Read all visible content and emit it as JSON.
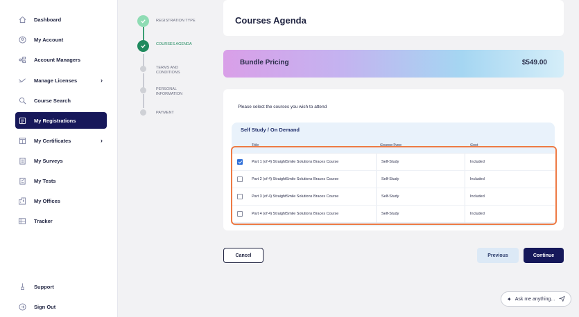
{
  "sidebar": {
    "items": [
      {
        "label": "Dashboard",
        "icon": "home-icon"
      },
      {
        "label": "My Account",
        "icon": "account-icon"
      },
      {
        "label": "Account Managers",
        "icon": "managers-icon"
      },
      {
        "label": "Manage Licenses",
        "icon": "license-icon",
        "chevron": "›"
      },
      {
        "label": "Course Search",
        "icon": "search-icon"
      },
      {
        "label": "My Registrations",
        "icon": "registrations-icon",
        "active": true
      },
      {
        "label": "My Certificates",
        "icon": "certificate-icon",
        "chevron": "›"
      },
      {
        "label": "My Surveys",
        "icon": "survey-icon"
      },
      {
        "label": "My Tests",
        "icon": "tests-icon"
      },
      {
        "label": "My Offices",
        "icon": "offices-icon"
      },
      {
        "label": "Tracker",
        "icon": "tracker-icon"
      }
    ],
    "support": "Support",
    "sign_out": "Sign Out"
  },
  "stepper": {
    "steps": [
      {
        "label": "REGISTRATION TYPE",
        "state": "done"
      },
      {
        "label": "COURSES AGENDA",
        "state": "current"
      },
      {
        "label": "TERMS AND CONDITIONS",
        "state": "pending"
      },
      {
        "label": "PERSONAL INFORMATION",
        "state": "pending"
      },
      {
        "label": "PAYMENT",
        "state": "pending"
      }
    ]
  },
  "main": {
    "title": "Courses Agenda",
    "bundle": {
      "label": "Bundle Pricing",
      "price": "$549.00"
    },
    "instruction": "Please select the courses you wish to attend",
    "section_title": "Self Study / On Demand",
    "table": {
      "headers": [
        "Title",
        "Course Type",
        "Cost"
      ],
      "rows": [
        {
          "title": "Part 1 (of 4) StraightSmile Solutions Braces Course",
          "type": "Self-Study",
          "cost": "Included",
          "checked": true
        },
        {
          "title": "Part 2 (of 4) StraightSmile Solutions Braces Course",
          "type": "Self-Study",
          "cost": "Included",
          "checked": false
        },
        {
          "title": "Part 3 (of 4) StraightSmile Solutions Braces Course",
          "type": "Self-Study",
          "cost": "Included",
          "checked": false
        },
        {
          "title": "Part 4 (of 4) StraightSmile Solutions Braces Course",
          "type": "Self-Study",
          "cost": "Included",
          "checked": false
        }
      ]
    },
    "buttons": {
      "cancel": "Cancel",
      "previous": "Previous",
      "continue": "Continue"
    }
  },
  "assistant": {
    "label": "Ask me anything..."
  },
  "colors": {
    "accent": "#15185a",
    "success": "#1f8a5e",
    "highlight": "#ee7a44"
  }
}
